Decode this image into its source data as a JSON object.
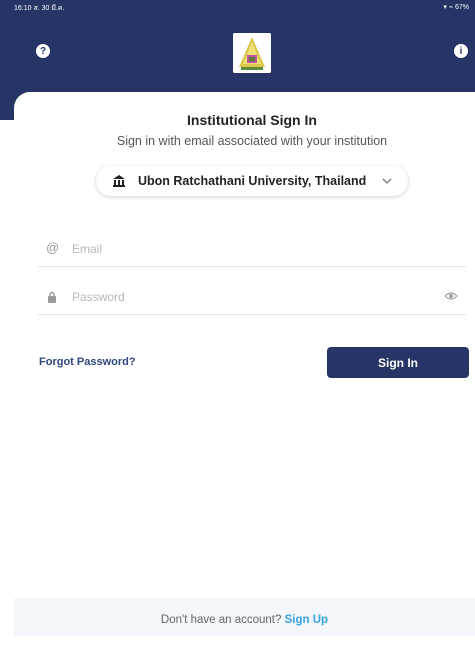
{
  "status_bar": {
    "time": "16:10  ส. 30 มี.ค.",
    "battery": "67%"
  },
  "header": {
    "help_symbol": "?",
    "info_symbol": "i"
  },
  "signin": {
    "title": "Institutional Sign In",
    "subtitle": "Sign in with email associated with your institution",
    "institution": "Ubon Ratchathani University, Thailand"
  },
  "form": {
    "email_placeholder": "Email",
    "password_placeholder": "Password",
    "forgot_label": "Forgot Password?",
    "signin_label": "Sign In"
  },
  "footer": {
    "prompt": "Don't have an account?",
    "signup_label": "Sign Up"
  },
  "colors": {
    "brand": "#263566",
    "link": "#3aa3e0"
  },
  "icons": [
    "help-icon",
    "info-icon",
    "institution-icon",
    "chevron-down-icon",
    "at-icon",
    "lock-icon",
    "eye-icon"
  ]
}
